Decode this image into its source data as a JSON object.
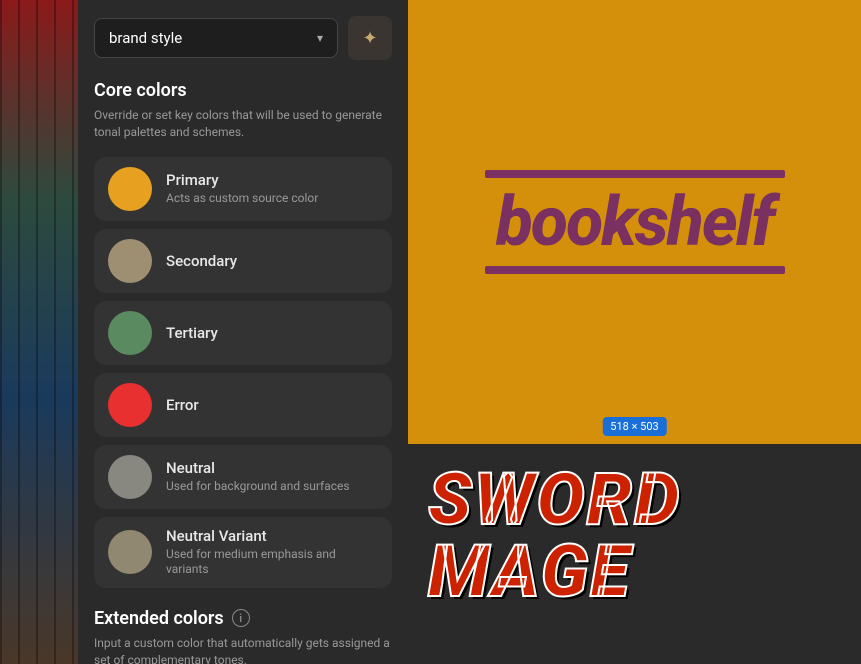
{
  "bookshelf_strip": {
    "label": "bookshelf background"
  },
  "panel": {
    "dropdown": {
      "label": "brand style",
      "arrow": "▾"
    },
    "magic_button": {
      "icon": "✦",
      "label": "magic wand"
    },
    "core_colors": {
      "title": "Core colors",
      "description": "Override or set key colors that will be used to generate tonal palettes and schemes.",
      "items": [
        {
          "name": "Primary",
          "description": "Acts as custom source color",
          "swatch_color": "#E8A020",
          "id": "primary"
        },
        {
          "name": "Secondary",
          "description": "",
          "swatch_color": "#9E8E72",
          "id": "secondary"
        },
        {
          "name": "Tertiary",
          "description": "",
          "swatch_color": "#5A8A60",
          "id": "tertiary"
        },
        {
          "name": "Error",
          "description": "",
          "swatch_color": "#E83030",
          "id": "error"
        },
        {
          "name": "Neutral",
          "description": "Used for background and surfaces",
          "swatch_color": "#888880",
          "id": "neutral"
        },
        {
          "name": "Neutral Variant",
          "description": "Used for medium emphasis and variants",
          "swatch_color": "#908870",
          "id": "neutral-variant"
        }
      ]
    },
    "extended_colors": {
      "title": "Extended colors",
      "info_icon": "i",
      "description": "Input a custom color that automatically gets assigned a set of complementary tones."
    }
  },
  "preview": {
    "logo_text": "bookshelf",
    "size_badge": "518 × 503",
    "sword_text": "SWORD MAGE"
  }
}
